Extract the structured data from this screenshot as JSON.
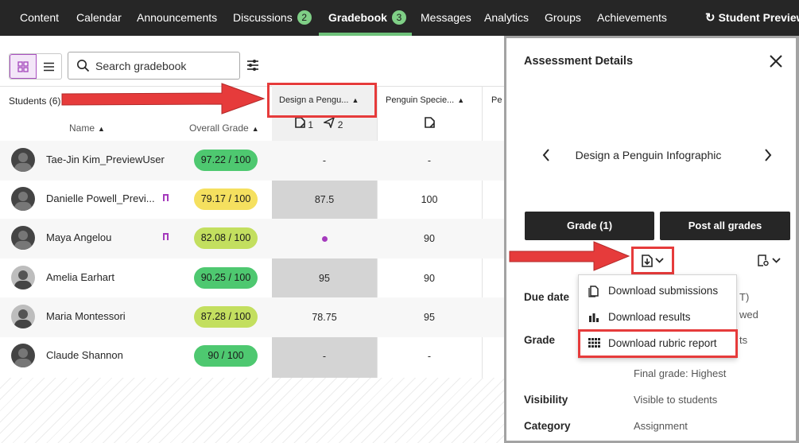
{
  "nav": {
    "tabs": [
      {
        "label": "Content"
      },
      {
        "label": "Calendar"
      },
      {
        "label": "Announcements"
      },
      {
        "label": "Discussions",
        "badge": "2"
      },
      {
        "label": "Gradebook",
        "badge": "3"
      },
      {
        "label": "Messages"
      },
      {
        "label": "Analytics"
      },
      {
        "label": "Groups"
      },
      {
        "label": "Achievements"
      }
    ],
    "student_preview": "Student Preview",
    "active_tab": "Gradebook"
  },
  "toolbar": {
    "search_placeholder": "Search gradebook",
    "view_mode": "grid"
  },
  "grid": {
    "students_label": "Students (6)",
    "name_header": "Name",
    "overall_header": "Overall Grade",
    "columns": [
      {
        "title": "Design a Pengu...",
        "submissions": "1",
        "posted": "2"
      },
      {
        "title": "Penguin Specie..."
      },
      {
        "title": "Pe"
      }
    ],
    "rows": [
      {
        "name": "Tae-Jin Kim_PreviewUser",
        "grade": "97.22 / 100",
        "grade_color": "#4ec870",
        "col1": "-",
        "col2": "-",
        "flag": false,
        "avatar": "silhouette"
      },
      {
        "name": "Danielle Powell_Previ...",
        "grade": "79.17 / 100",
        "grade_color": "#f5e05f",
        "col1": "87.5",
        "col2": "100",
        "flag": true,
        "avatar": "silhouette"
      },
      {
        "name": "Maya Angelou",
        "grade": "82.08 / 100",
        "grade_color": "#c3df5f",
        "col1": "",
        "col1_dot": true,
        "col2": "90",
        "flag": true,
        "avatar": "silhouette"
      },
      {
        "name": "Amelia Earhart",
        "grade": "90.25 / 100",
        "grade_color": "#4ec870",
        "col1": "95",
        "col2": "90",
        "flag": false,
        "avatar": "photo"
      },
      {
        "name": "Maria Montessori",
        "grade": "87.28 / 100",
        "grade_color": "#c3df5f",
        "col1": "78.75",
        "col2": "95",
        "flag": false,
        "avatar": "photo"
      },
      {
        "name": "Claude Shannon",
        "grade": "90 / 100",
        "grade_color": "#4ec870",
        "col1": "-",
        "col2": "-",
        "flag": false,
        "avatar": "silhouette"
      }
    ]
  },
  "panel": {
    "title": "Assessment Details",
    "item_title": "Design a Penguin Infographic",
    "grade_button": "Grade (1)",
    "post_button": "Post all grades",
    "due_date_label": "Due date",
    "due_date_peek_1": "T)",
    "due_date_peek_2": "wed",
    "grade_label": "Grade",
    "grade_peek": "ts",
    "final_grade": "Final grade: Highest",
    "visibility_label": "Visibility",
    "visibility_value": "Visible to students",
    "category_label": "Category",
    "category_value": "Assignment"
  },
  "download_menu": {
    "items": [
      {
        "label": "Download submissions",
        "icon": "document-icon"
      },
      {
        "label": "Download results",
        "icon": "bar-chart-icon"
      },
      {
        "label": "Download rubric report",
        "icon": "rubric-icon"
      }
    ]
  },
  "colors": {
    "nav_bg": "#262626",
    "active_underline": "#6ec17a",
    "highlight": "#e63b3b",
    "accent_purple": "#a53bbd"
  }
}
